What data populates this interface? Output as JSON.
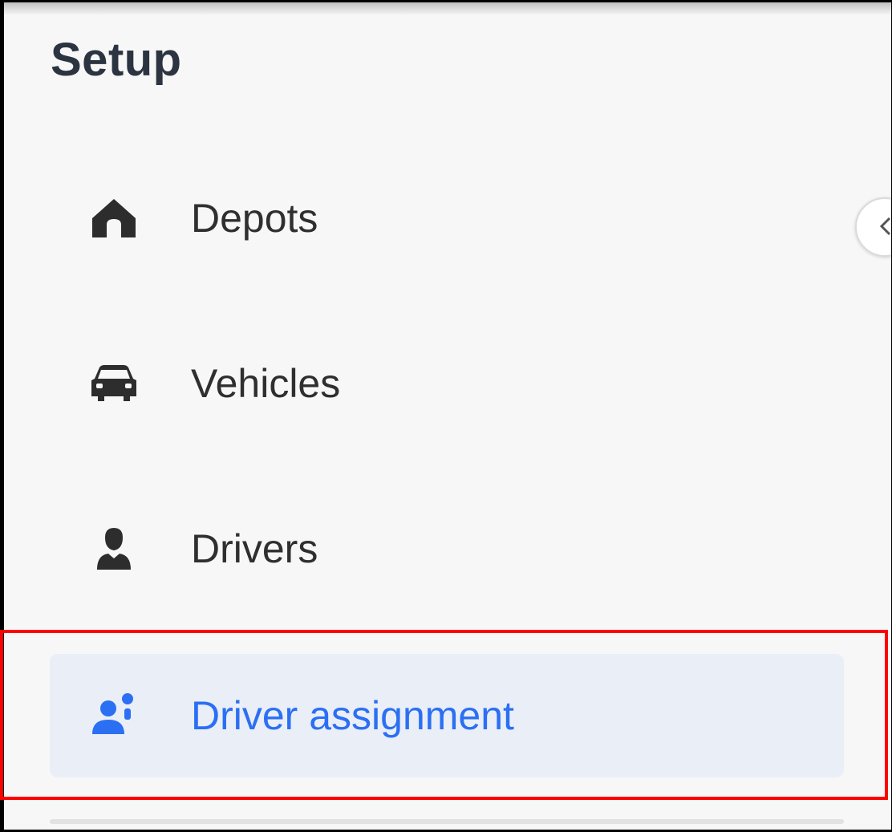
{
  "sidebar": {
    "title": "Setup",
    "items": [
      {
        "label": "Depots",
        "icon": "home-icon",
        "active": false
      },
      {
        "label": "Vehicles",
        "icon": "car-icon",
        "active": false
      },
      {
        "label": "Drivers",
        "icon": "person-icon",
        "active": false
      },
      {
        "label": "Driver assignment",
        "icon": "driver-assignment-icon",
        "active": true
      }
    ],
    "collapse_icon": "chevron-left-icon"
  },
  "colors": {
    "active_text": "#2b6ff3",
    "active_background": "#e9eef7",
    "text": "#2f2f2f",
    "title": "#2b3440",
    "panel_background": "#f7f7f7",
    "highlight_border": "#ff0000"
  }
}
